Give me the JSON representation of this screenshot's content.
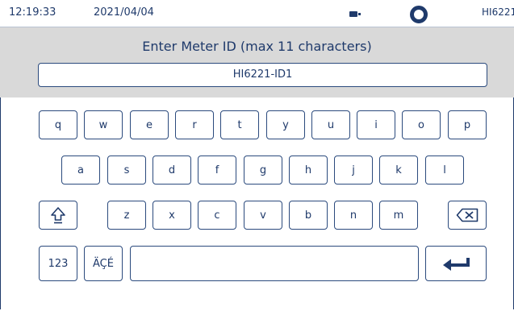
{
  "status_bar": {
    "time": "12:19:33",
    "date": "2021/04/04",
    "device": "HI6221",
    "icons": [
      "battery-icon",
      "record-ring-icon"
    ]
  },
  "entry": {
    "prompt": "Enter Meter ID (max 11 characters)",
    "value": "HI6221-ID1"
  },
  "keyboard": {
    "row1": [
      "q",
      "w",
      "e",
      "r",
      "t",
      "y",
      "u",
      "i",
      "o",
      "p"
    ],
    "row2": [
      "a",
      "s",
      "d",
      "f",
      "g",
      "h",
      "j",
      "k",
      "l"
    ],
    "row3": [
      "z",
      "x",
      "c",
      "v",
      "b",
      "n",
      "m"
    ],
    "numbers_label": "123",
    "accents_label": "ÄÇÉ",
    "special_icons": [
      "shift-icon",
      "backspace-icon",
      "enter-icon"
    ]
  },
  "colors": {
    "accent": "#1f3a6b",
    "header_bg": "#d9d9d9",
    "key_border": "#2b4a7d"
  }
}
